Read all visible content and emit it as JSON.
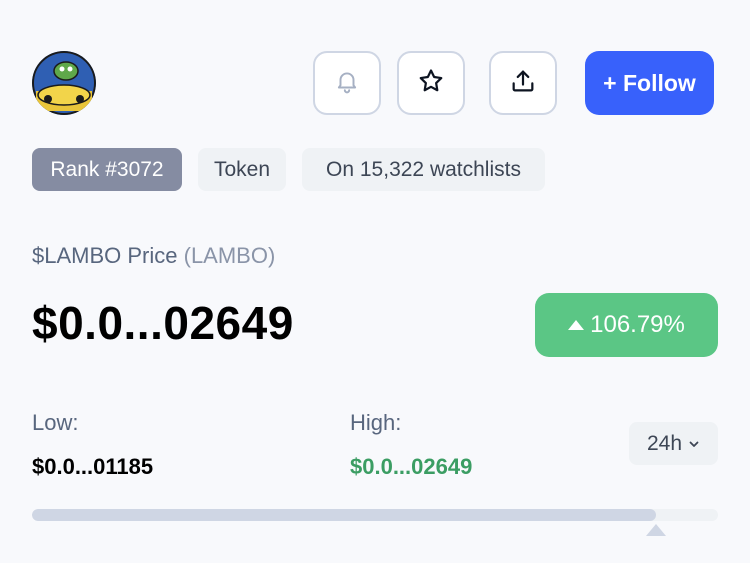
{
  "header": {
    "follow_label": "+ Follow",
    "icons": [
      "bell-icon",
      "star-icon",
      "share-icon"
    ]
  },
  "tags": {
    "rank": "Rank #3072",
    "type": "Token",
    "watchlists": "On 15,322 watchlists"
  },
  "price_block": {
    "name": "$LAMBO Price",
    "symbol": "(LAMBO)",
    "price": "$0.0...02649",
    "change": "106.79%",
    "change_direction": "up"
  },
  "range": {
    "low_label": "Low:",
    "low_value": "$0.0...01185",
    "high_label": "High:",
    "high_value": "$0.0...02649",
    "period": "24h",
    "position_percent": 91
  },
  "colors": {
    "accent": "#3861fb",
    "positive": "#5bc685",
    "positive_text": "#3b9d63",
    "rank_tag": "#858ca2"
  }
}
